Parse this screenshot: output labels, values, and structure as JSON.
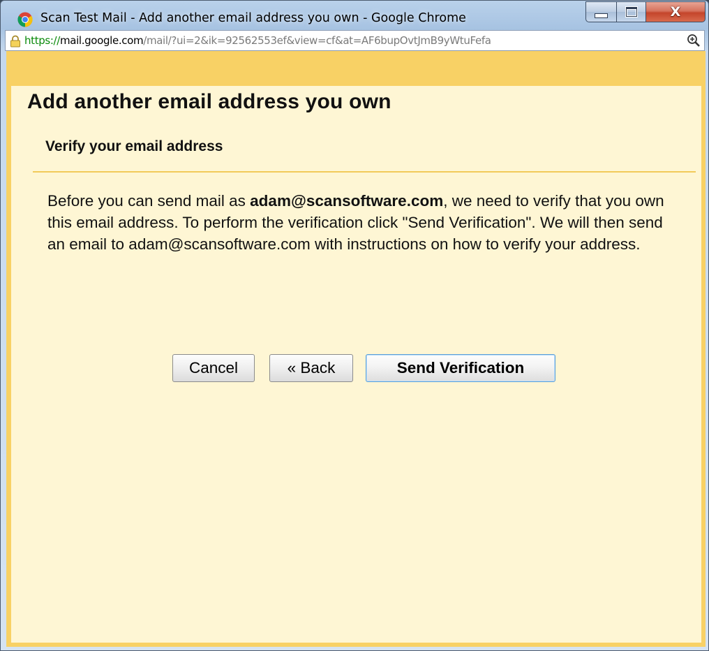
{
  "window": {
    "title": "Scan Test Mail - Add another email address you own - Google Chrome",
    "minimize_label": "",
    "close_label": "X"
  },
  "addressbar": {
    "scheme": "https://",
    "host": "mail.google.com",
    "path": "/mail/?ui=2&ik=92562553ef&view=cf&at=AF6bupOvtJmB9yWtuFefa"
  },
  "dialog": {
    "header_title": "Add another email address you own",
    "subtitle": "Verify your email address",
    "body_prefix": "Before you can send mail as ",
    "body_email_bold": "adam@scansoftware.com",
    "body_suffix": ", we need to verify that you own this email address. To perform the verification click \"Send Verification\". We will then send an email to adam@scansoftware.com with instructions on how to verify your address.",
    "buttons": {
      "cancel": "Cancel",
      "back": "« Back",
      "send": "Send Verification"
    }
  },
  "colors": {
    "header_bg": "#f8d165",
    "page_bg": "#fef6d4",
    "divider": "#f2ca5a",
    "https_green": "#0a8a0a",
    "primary_focus": "#5a9ed8"
  },
  "icons": {
    "app": "chrome-logo-icon",
    "lock": "lock-icon",
    "zoom": "zoom-in-icon",
    "minimize": "minimize-icon",
    "maximize": "maximize-icon",
    "close": "close-icon"
  }
}
